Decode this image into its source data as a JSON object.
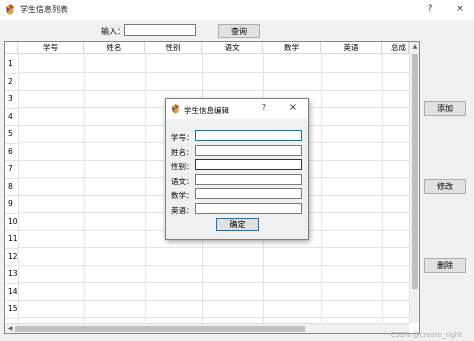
{
  "window": {
    "title": "学生信息列表",
    "help_glyph": "?",
    "close_glyph": "×"
  },
  "search": {
    "label": "输入：",
    "value": "",
    "button_label": "查询"
  },
  "table": {
    "columns": [
      "学号",
      "姓名",
      "性别",
      "语文",
      "数学",
      "英语",
      "总成"
    ],
    "row_numbers": [
      "1",
      "2",
      "3",
      "4",
      "5",
      "6",
      "7",
      "8",
      "9",
      "10",
      "11",
      "12",
      "13",
      "14",
      "15"
    ]
  },
  "actions": {
    "add_label": "添加",
    "edit_label": "修改",
    "delete_label": "删除"
  },
  "dialog": {
    "title": "学生信息编辑",
    "help_glyph": "?",
    "close_glyph": "×",
    "fields": [
      {
        "label": "学号：",
        "value": ""
      },
      {
        "label": "姓名：",
        "value": ""
      },
      {
        "label": "性别：",
        "value": ""
      },
      {
        "label": "语文：",
        "value": ""
      },
      {
        "label": "数学：",
        "value": ""
      },
      {
        "label": "英语：",
        "value": ""
      }
    ],
    "ok_label": "确定"
  },
  "watermark": "CSDN @create_right",
  "colors": {
    "accent": "#0078d7",
    "window_bg": "#f0f0f0",
    "button_bg": "#e1e1e1"
  }
}
